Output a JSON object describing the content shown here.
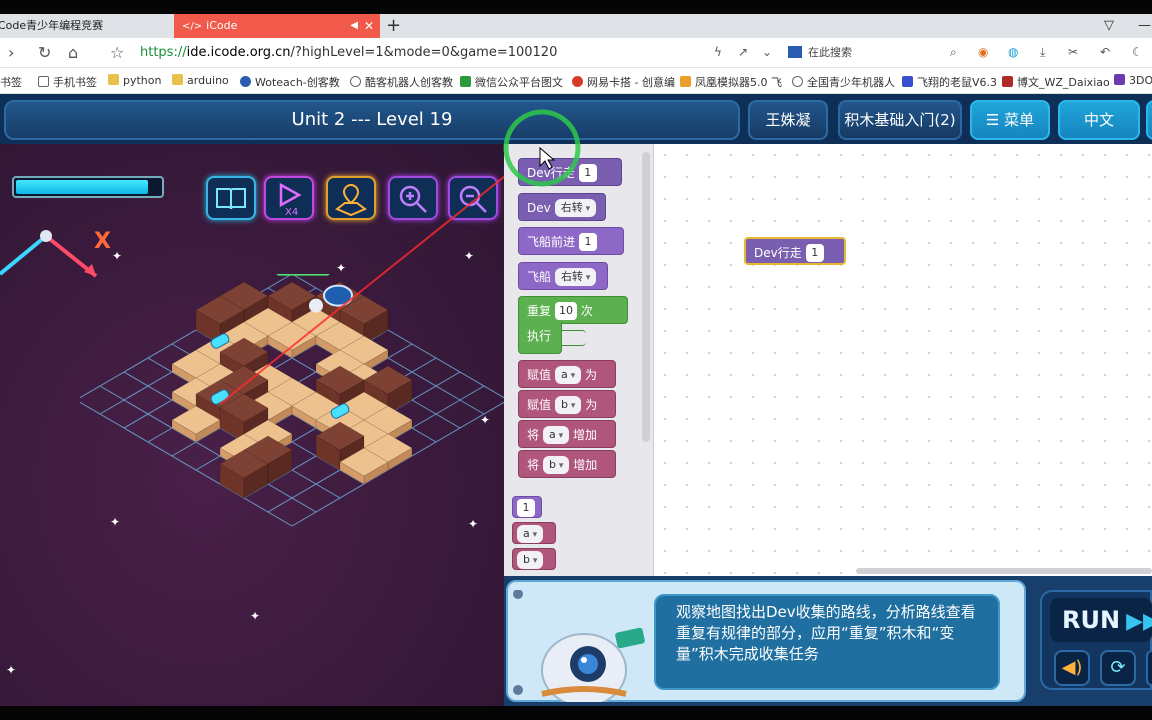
{
  "browser": {
    "tabs": [
      {
        "label": "Code青少年编程竞赛"
      },
      {
        "label": "iCode",
        "favicon": "</>",
        "mute": "◀",
        "close": "✕"
      }
    ],
    "new_tab": "+",
    "nav": {
      "back": "›",
      "reload": "↻",
      "home": "⌂",
      "star": "☆"
    },
    "url_scheme": "https://",
    "url_domain": "ide.icode.org.cn",
    "url_rest": "/?highLevel=1&mode=0&game=100120",
    "search_placeholder": "在此搜索",
    "bookmarks": [
      "书签",
      "手机书签",
      "python",
      "arduino",
      "Woteach-创客教",
      "酷客机器人创客教",
      "微信公众平台图文",
      "网易卡搭 - 创意编",
      "凤凰模拟器5.0 飞",
      "全国青少年机器人",
      "飞翔的老鼠V6.3",
      "博文_WZ_Daixiao",
      "3DO"
    ]
  },
  "header": {
    "level_title": "Unit 2 --- Level 19",
    "user_name": "王姝凝",
    "course": "积木基础入门(2)",
    "menu_label": "☰ 菜单",
    "lang_label": "中文"
  },
  "game": {
    "progress": 0.92,
    "x_mark": "X",
    "tools": [
      "book-icon",
      "speed-x4-icon",
      "map-pin-icon",
      "zoom-in-icon",
      "zoom-out-icon"
    ],
    "speed_label": "X4"
  },
  "toolbox": {
    "blocks": [
      {
        "label": "Dev行走",
        "value": "1"
      },
      {
        "label": "Dev",
        "dropdown": "右转"
      },
      {
        "label": "飞船前进",
        "value": "1"
      },
      {
        "label": "飞船",
        "dropdown": "右转"
      },
      {
        "label": "重复",
        "value": "10",
        "suffix": "次",
        "body": "执行"
      },
      {
        "label": "赋值",
        "dropdown": "a",
        "suffix": "为"
      },
      {
        "label": "赋值",
        "dropdown": "b",
        "suffix": "为"
      },
      {
        "label": "将",
        "dropdown": "a",
        "suffix": "增加"
      },
      {
        "label": "将",
        "dropdown": "b",
        "suffix": "增加"
      },
      {
        "value": "1"
      },
      {
        "dropdown": "a"
      },
      {
        "dropdown": "b"
      }
    ]
  },
  "workspace": {
    "placed_block": {
      "label": "Dev行走",
      "value": "1"
    }
  },
  "hint": {
    "text": "观察地图找出Dev收集的路线，分析路线查看重复有规律的部分，应用“重复”积木和“变量”积木完成收集任务"
  },
  "controls": {
    "run_label": "RUN",
    "run_ff": "▶▶",
    "sound_icon": "speaker-icon",
    "reset_icon": "refresh-icon"
  },
  "colors": {
    "header_bg": "#0e2f57",
    "accent_cyan": "#1c9fd6",
    "block_purple": "#7a5fb0",
    "block_green": "#5cb050",
    "block_pink": "#b0557c",
    "active_tab": "#f15a4a"
  }
}
